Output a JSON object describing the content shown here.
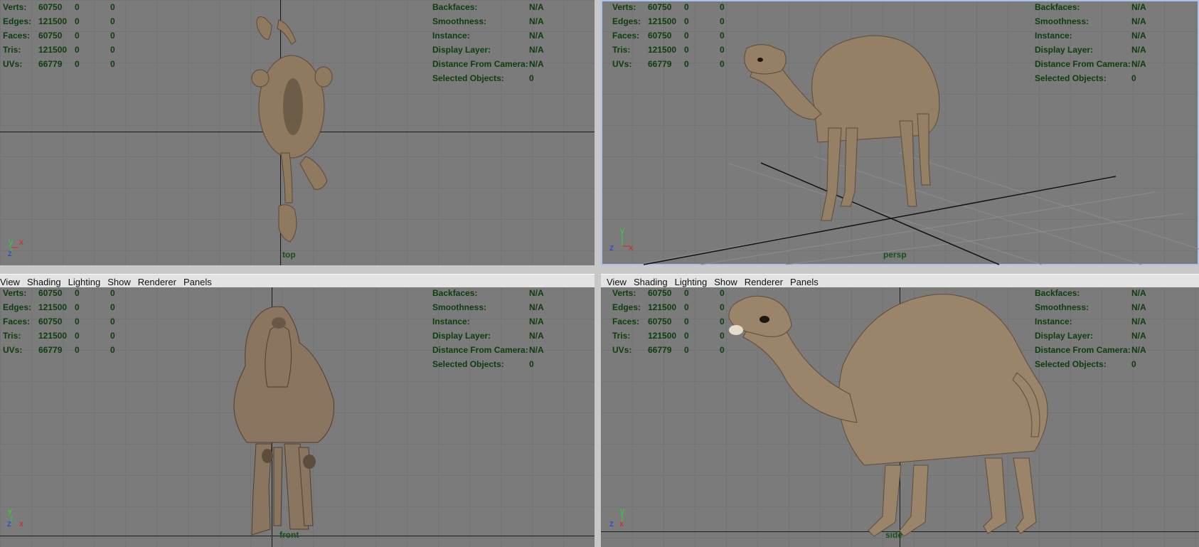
{
  "stats": {
    "labels": [
      "Verts:",
      "Edges:",
      "Faces:",
      "Tris:",
      "UVs:"
    ],
    "values": [
      [
        "60750",
        "0",
        "0"
      ],
      [
        "121500",
        "0",
        "0"
      ],
      [
        "60750",
        "0",
        "0"
      ],
      [
        "121500",
        "0",
        "0"
      ],
      [
        "66779",
        "0",
        "0"
      ]
    ]
  },
  "info": {
    "labels": [
      "Backfaces:",
      "Smoothness:",
      "Instance:",
      "Display Layer:",
      "Distance From Camera:",
      "Selected Objects:"
    ],
    "values": [
      "N/A",
      "N/A",
      "N/A",
      "N/A",
      "N/A",
      "0"
    ]
  },
  "menu": [
    "View",
    "Shading",
    "Lighting",
    "Show",
    "Renderer",
    "Panels"
  ],
  "viewports": {
    "top": {
      "camera": "top",
      "axis1": "y",
      "axis2": "x",
      "axis3": "z"
    },
    "persp": {
      "camera": "persp",
      "axis1": "y",
      "axis2": "x",
      "axis3": "z"
    },
    "front": {
      "camera": "front",
      "axis1": "y",
      "axis2": "x",
      "axis3": "z"
    },
    "side": {
      "camera": "side",
      "axis1": "y",
      "axis2": "x",
      "axis3": "z"
    }
  },
  "colors": {
    "viewport_bg": "#7b7b7b",
    "hud_text": "#0c3d0c",
    "axis_y": "#2bd52b",
    "axis_x": "#e02020",
    "axis_z": "#2040e0",
    "camel": "#8f7a60"
  }
}
